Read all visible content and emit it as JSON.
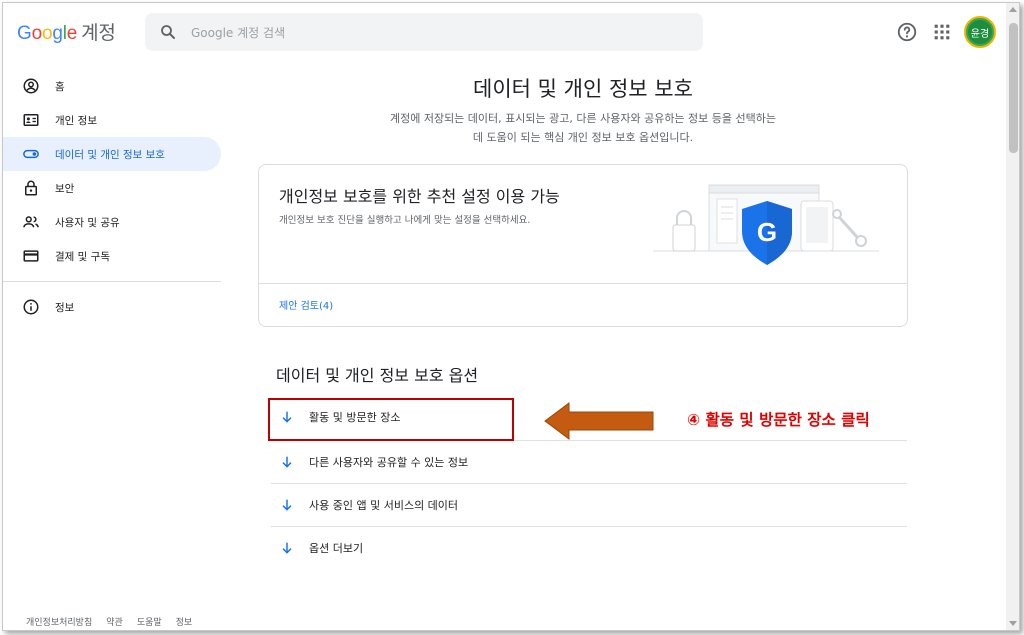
{
  "header": {
    "logo": {
      "g1": "G",
      "o1": "o",
      "o2": "o",
      "g2": "g",
      "l": "l",
      "e": "e",
      "account": "계정"
    },
    "search_placeholder": "Google 계정 검색",
    "avatar_text": "윤경"
  },
  "sidebar": {
    "items": [
      {
        "label": "홈",
        "icon": "home-icon",
        "active": false
      },
      {
        "label": "개인 정보",
        "icon": "id-card-icon",
        "active": false
      },
      {
        "label": "데이터 및 개인 정보 보호",
        "icon": "toggle-icon",
        "active": true
      },
      {
        "label": "보안",
        "icon": "lock-icon",
        "active": false
      },
      {
        "label": "사용자 및 공유",
        "icon": "people-icon",
        "active": false
      },
      {
        "label": "결제 및 구독",
        "icon": "credit-card-icon",
        "active": false
      },
      {
        "label": "정보",
        "icon": "info-icon",
        "active": false
      }
    ]
  },
  "footer": {
    "links": [
      "개인정보처리방침",
      "약관",
      "도움말",
      "정보"
    ]
  },
  "main": {
    "title": "데이터 및 개인 정보 보호",
    "subtitle_line1": "계정에 저장되는 데이터, 표시되는 광고, 다른 사용자와 공유하는 정보 등을 선택하는",
    "subtitle_line2": "데 도움이 되는 핵심 개인 정보 보호 옵션입니다.",
    "card": {
      "title": "개인정보 보호를 위한 추천 설정 이용 가능",
      "description": "개인정보 보호 진단을 실행하고 나에게 맞는 설정을 선택하세요.",
      "shield_letter": "G",
      "link": "제안 검토(4)"
    },
    "section_title": "데이터 및 개인 정보 보호 옵션",
    "options": [
      "활동 및 방문한 장소",
      "다른 사용자와 공유할 수 있는 정보",
      "사용 중인 앱 및 서비스의 데이터",
      "옵션 더보기"
    ]
  },
  "annotation": {
    "text": "④ 활동 및 방문한 장소 클릭"
  },
  "colors": {
    "accent": "#1a73e8",
    "active_bg": "#e8f0fe",
    "annotation_red": "#e00000",
    "arrow_orange": "#c55a11"
  }
}
